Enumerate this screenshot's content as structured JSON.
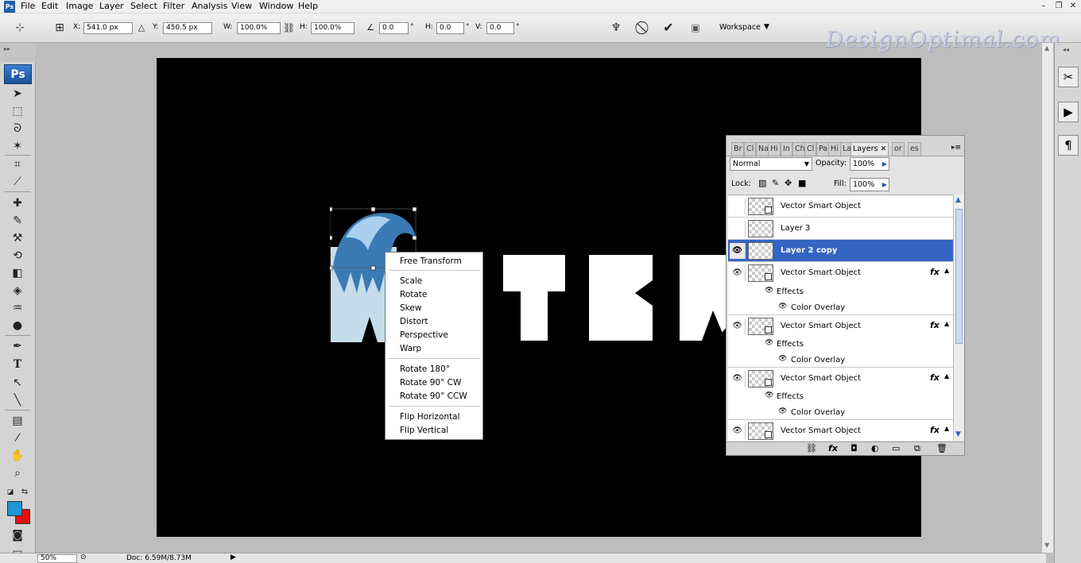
{
  "app": {
    "logo_text": "Ps",
    "menu": [
      "File",
      "Edit",
      "Image",
      "Layer",
      "Select",
      "Filter",
      "Analysis",
      "View",
      "Window",
      "Help"
    ]
  },
  "options": {
    "x_label": "X:",
    "x_value": "541.0 px",
    "y_label": "Y:",
    "y_value": "450.5 px",
    "w_label": "W:",
    "w_value": "100.0%",
    "h_label": "H:",
    "h_value": "100.0%",
    "angle_value": "0.0",
    "angle_unit": "°",
    "hskew_label": "H:",
    "hskew_value": "0.0",
    "hskew_unit": "°",
    "vskew_label": "V:",
    "vskew_value": "0.0",
    "vskew_unit": "°",
    "workspace_label": "Workspace"
  },
  "watermark": "DesignOptimal.com",
  "status": {
    "zoom": "50%",
    "doc": "Doc: 6.59M/8.73M"
  },
  "context_menu": {
    "group1": [
      "Free Transform"
    ],
    "group2": [
      "Scale",
      "Rotate",
      "Skew",
      "Distort",
      "Perspective",
      "Warp"
    ],
    "group3": [
      "Rotate 180°",
      "Rotate 90° CW",
      "Rotate 90° CCW"
    ],
    "group4": [
      "Flip Horizontal",
      "Flip Vertical"
    ]
  },
  "layers_panel": {
    "tabs": [
      "Br",
      "Cl",
      "Na",
      "Hi",
      "In",
      "Ch",
      "Cl",
      "Pa",
      "Hi",
      "La",
      "Layers",
      "or",
      "es"
    ],
    "active_tab": "Layers",
    "blend_mode": "Normal",
    "opacity_label": "Opacity:",
    "opacity_value": "100%",
    "lock_label": "Lock:",
    "fill_label": "Fill:",
    "fill_value": "100%",
    "layers": [
      {
        "name": "Vector Smart Object",
        "visible": false,
        "type": "smart"
      },
      {
        "name": "Layer 3",
        "visible": false,
        "type": "layer"
      },
      {
        "name": "Layer 2 copy",
        "visible": true,
        "type": "layer",
        "selected": true
      },
      {
        "name": "Vector Smart Object",
        "visible": true,
        "type": "smart",
        "fx": true,
        "effects_label": "Effects",
        "effect": "Color Overlay"
      },
      {
        "name": "Vector Smart Object",
        "visible": true,
        "type": "smart",
        "fx": true,
        "effects_label": "Effects",
        "effect": "Color Overlay"
      },
      {
        "name": "Vector Smart Object",
        "visible": true,
        "type": "smart",
        "fx": true,
        "effects_label": "Effects",
        "effect": "Color Overlay"
      },
      {
        "name": "Vector Smart Object",
        "visible": true,
        "type": "smart",
        "fx": true
      }
    ],
    "fx_label": "fx"
  },
  "colors": {
    "foreground": "#1e95d6",
    "background": "#e31010",
    "selection": "#3465c4",
    "water_letter": "#c5dceb"
  }
}
